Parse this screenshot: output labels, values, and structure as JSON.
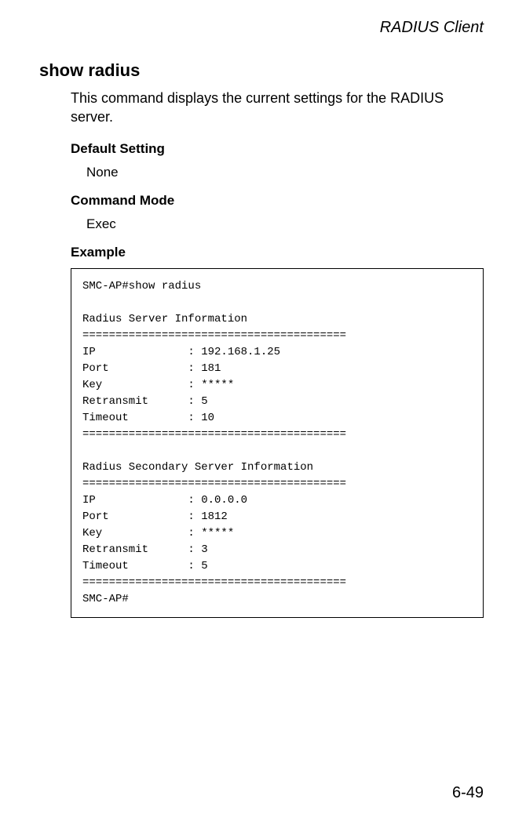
{
  "header": {
    "context": "RADIUS Client"
  },
  "command": {
    "title": "show radius",
    "description": "This command displays the current settings for the RADIUS server."
  },
  "sections": {
    "default_setting_label": "Default Setting",
    "default_setting_value": "None",
    "command_mode_label": "Command Mode",
    "command_mode_value": "Exec",
    "example_label": "Example"
  },
  "example_output": "SMC-AP#show radius\n\nRadius Server Information\n========================================\nIP              : 192.168.1.25\nPort            : 181\nKey             : *****\nRetransmit      : 5\nTimeout         : 10\n========================================\n\nRadius Secondary Server Information\n========================================\nIP              : 0.0.0.0\nPort            : 1812\nKey             : *****\nRetransmit      : 3\nTimeout         : 5\n========================================\nSMC-AP#",
  "footer": {
    "page_number": "6-49"
  }
}
